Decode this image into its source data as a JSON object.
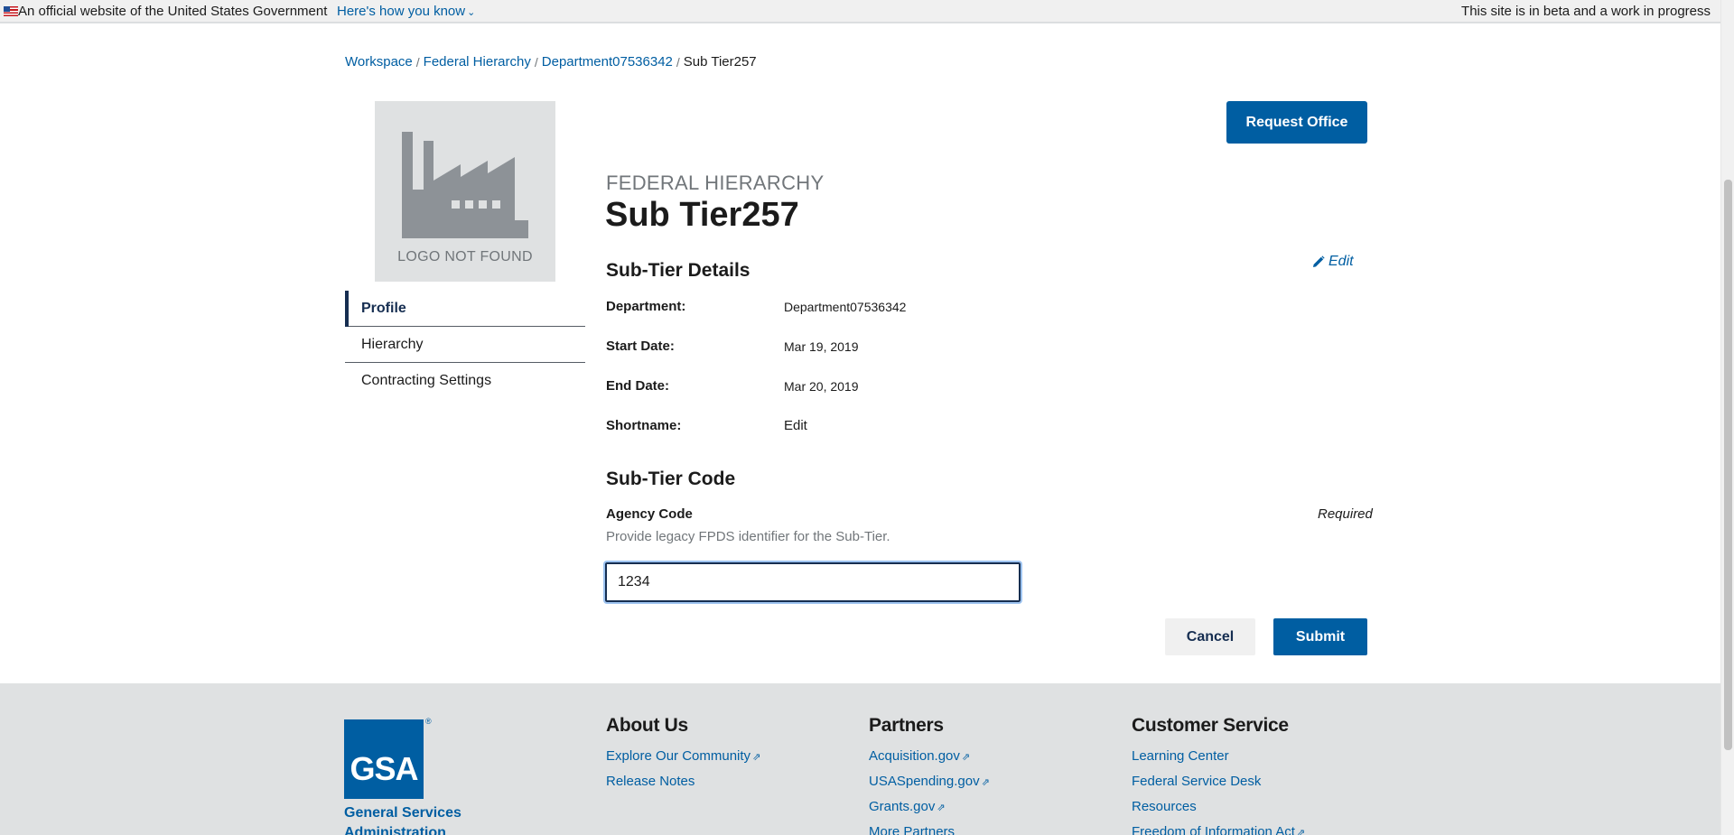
{
  "gov_banner": {
    "official_text": "An official website of the United States Government",
    "how_you_know": "Here's how you know",
    "beta_text": "This site is in beta and a work in progress"
  },
  "breadcrumb": {
    "items": [
      "Workspace",
      "Federal Hierarchy",
      "Department07536342"
    ],
    "current": "Sub Tier257"
  },
  "logo": {
    "placeholder_text": "LOGO NOT FOUND"
  },
  "sidenav": {
    "items": [
      "Profile",
      "Hierarchy",
      "Contracting Settings"
    ],
    "active": "Profile"
  },
  "header": {
    "request_button": "Request Office",
    "eyebrow": "FEDERAL HIERARCHY",
    "title": "Sub Tier257"
  },
  "details": {
    "heading": "Sub-Tier Details",
    "edit_label": "Edit",
    "rows": [
      {
        "label": "Department:",
        "value": "Department07536342"
      },
      {
        "label": "Start Date:",
        "value": "Mar 19, 2019"
      },
      {
        "label": "End Date:",
        "value": "Mar 20, 2019"
      },
      {
        "label": "Shortname:",
        "value": "Edit"
      }
    ]
  },
  "subtier_code": {
    "heading": "Sub-Tier Code",
    "field_label": "Agency Code",
    "required_label": "Required",
    "hint": "Provide legacy FPDS identifier for the Sub-Tier.",
    "input_value": "1234",
    "cancel_label": "Cancel",
    "submit_label": "Submit"
  },
  "footer": {
    "gsa_logo_text": "GSA",
    "gsa_registered": "®",
    "gsa_name": "General Services Administration",
    "columns": [
      {
        "heading": "About Us",
        "links": [
          {
            "label": "Explore Our Community",
            "external": true
          },
          {
            "label": "Release Notes",
            "external": false
          }
        ]
      },
      {
        "heading": "Partners",
        "links": [
          {
            "label": "Acquisition.gov",
            "external": true
          },
          {
            "label": "USASpending.gov",
            "external": true
          },
          {
            "label": "Grants.gov",
            "external": true
          },
          {
            "label": "More Partners",
            "external": false
          }
        ]
      },
      {
        "heading": "Customer Service",
        "links": [
          {
            "label": "Learning Center",
            "external": false
          },
          {
            "label": "Federal Service Desk",
            "external": false
          },
          {
            "label": "Resources",
            "external": false
          },
          {
            "label": "Freedom of Information Act",
            "external": true
          }
        ]
      }
    ]
  },
  "colors": {
    "primary": "#005ea2",
    "primary_dark": "#162e51",
    "footer_bg": "#dfe1e2",
    "banner_bg": "#f0f0f0",
    "muted_text": "#71767a"
  },
  "icons": {
    "flag": "us-flag-icon",
    "chevron": "chevron-down-icon",
    "edit": "pencil-icon",
    "external": "external-link-icon",
    "logo_placeholder": "factory-icon"
  }
}
